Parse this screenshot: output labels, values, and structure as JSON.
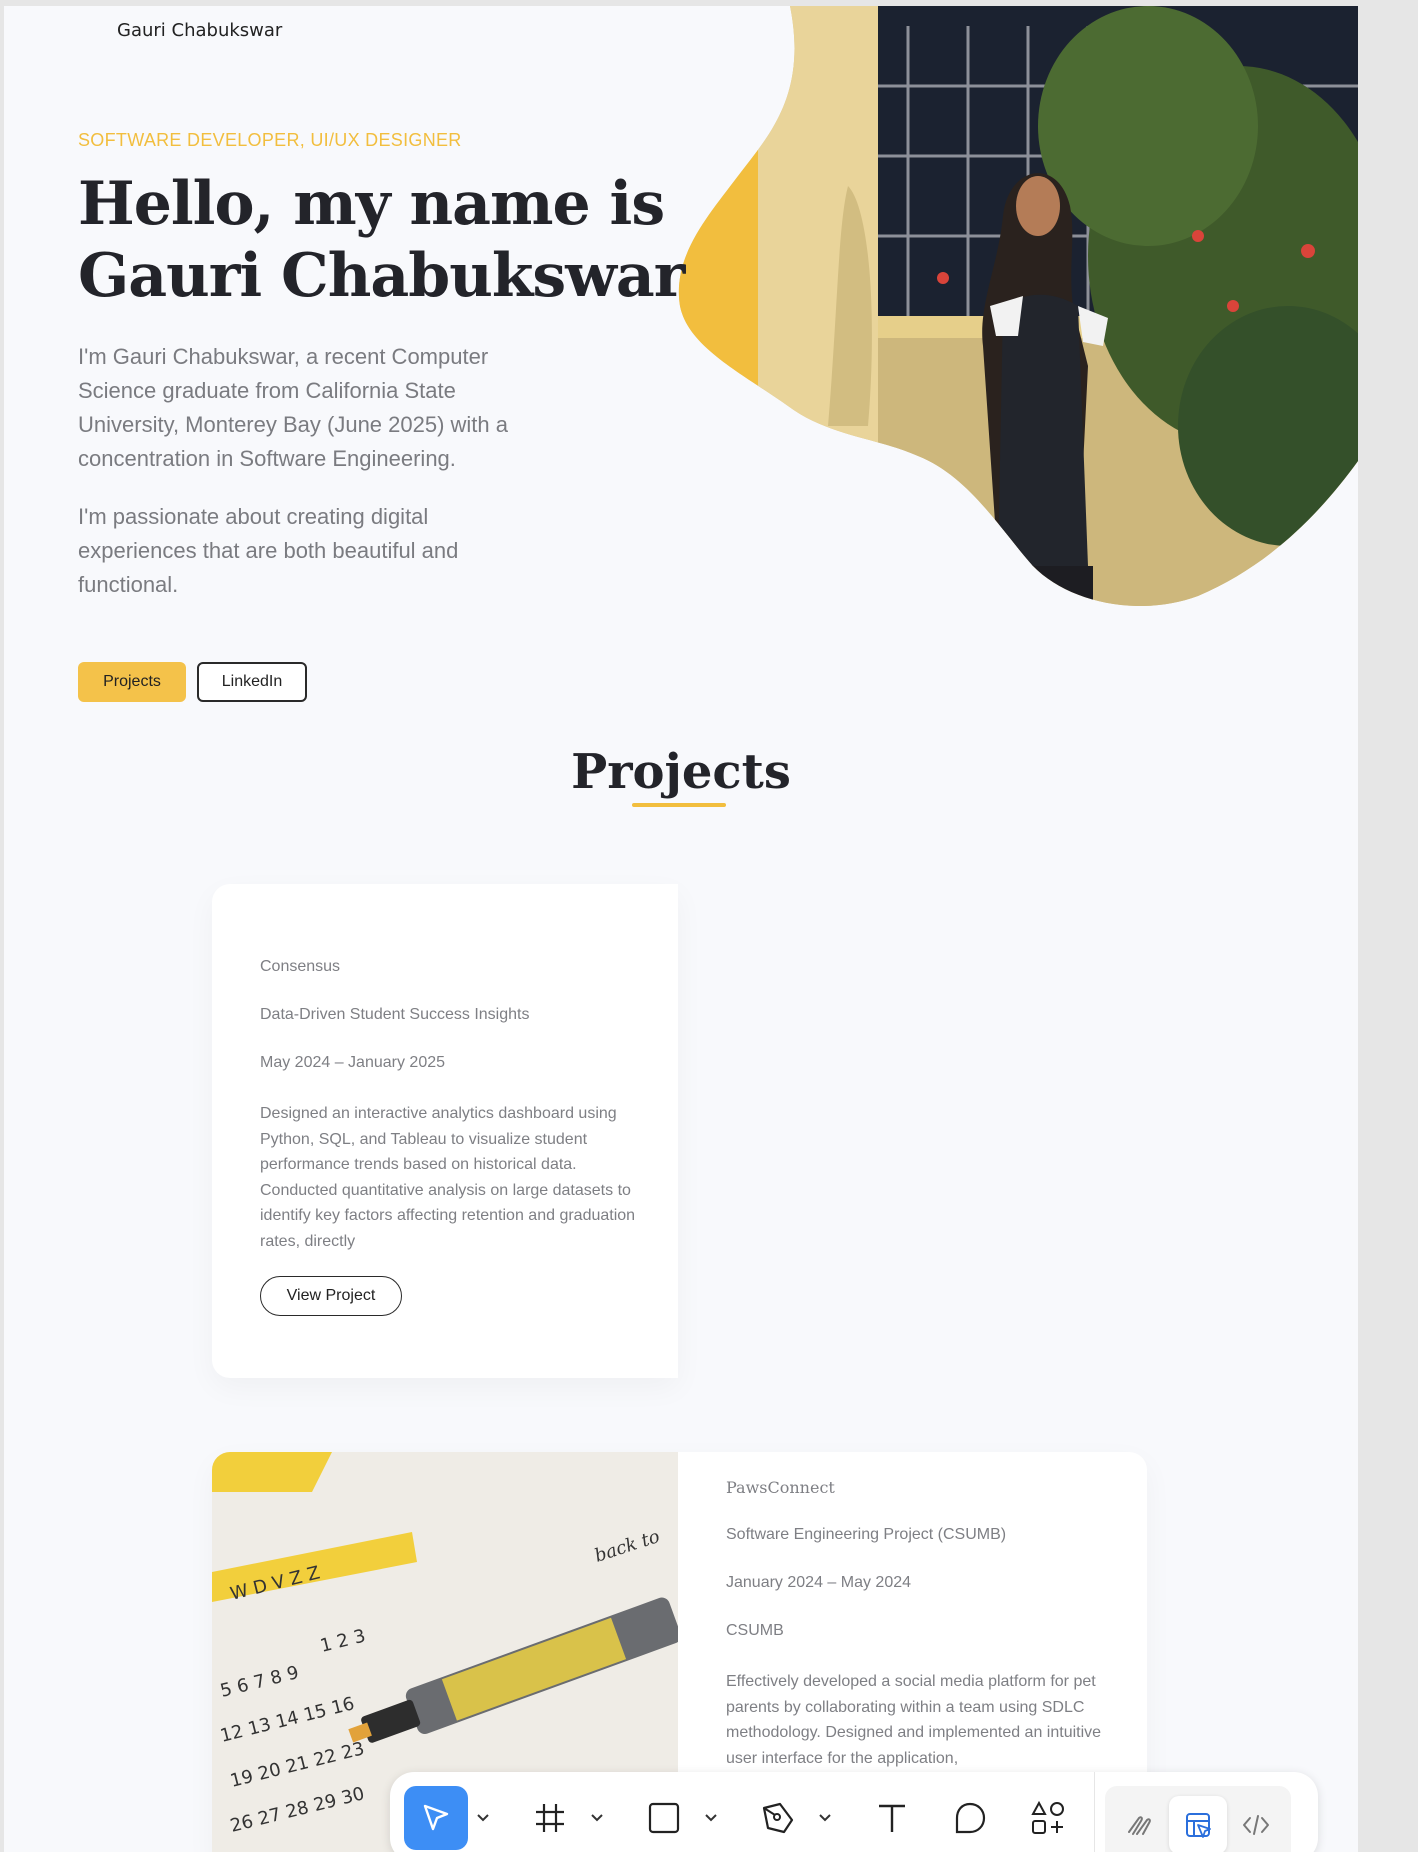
{
  "site": {
    "logo_text": "Gauri Chabukswar"
  },
  "hero": {
    "subtitle": "SOFTWARE DEVELOPER, UI/UX DESIGNER",
    "title_line1": "Hello, my name is",
    "title_line2": "Gauri Chabukswar",
    "intro_p1": "I'm Gauri Chabukswar, a recent Computer Science graduate from California State University, Monterey Bay (June 2025) with a concentration in Software Engineering.",
    "intro_p2": "I'm passionate about creating digital experiences that are both beautiful and functional.",
    "buttons": {
      "projects": "Projects",
      "linkedin": "LinkedIn"
    }
  },
  "projects_section": {
    "title": "Projects",
    "items": [
      {
        "name": "Consensus",
        "subtitle": "Data-Driven Student Success Insights",
        "date": "May 2024 – January 2025",
        "description": "Designed an interactive analytics dashboard using Python, SQL, and Tableau to visualize student performance trends based on historical data. Conducted quantitative analysis on large datasets to identify key factors affecting retention and graduation rates, directly",
        "button": "View Project"
      },
      {
        "name": "PawsConnect",
        "subtitle": "Software Engineering Project (CSUMB)",
        "date": "January 2024 – May 2024",
        "org": "CSUMB",
        "description": "Effectively developed a social media platform for pet parents by collaborating within a team using SDLC methodology. Designed and implemented an intuitive user interface for the application,"
      }
    ]
  },
  "toolbar": {
    "tools": [
      "move-tool",
      "frame-tool",
      "shape-tool",
      "pen-tool",
      "text-tool",
      "comment-tool",
      "actions-tool"
    ],
    "mode_tools": [
      "draw-mode",
      "design-mode",
      "dev-mode"
    ],
    "active_tool": "move-tool",
    "active_mode": "design-mode",
    "accent_color": "#3d8ef5"
  },
  "colors": {
    "accent": "#f2be3e",
    "heading": "#23242a",
    "body_text": "#7a7b80"
  }
}
